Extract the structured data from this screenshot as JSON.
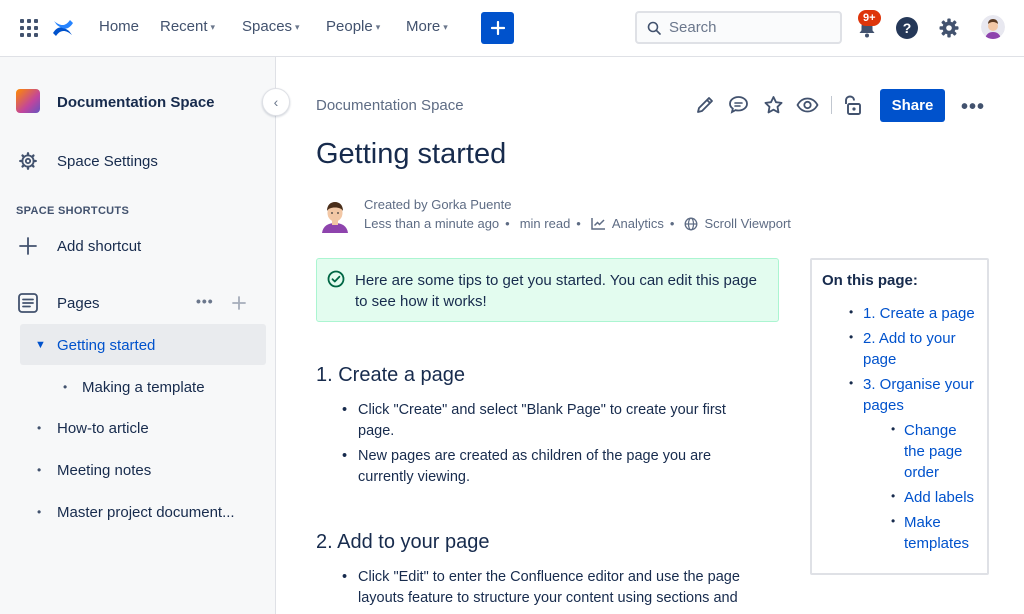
{
  "topnav": {
    "items": [
      {
        "label": "Home",
        "dropdown": false
      },
      {
        "label": "Recent",
        "dropdown": true
      },
      {
        "label": "Spaces",
        "dropdown": true
      },
      {
        "label": "People",
        "dropdown": true
      },
      {
        "label": "More",
        "dropdown": true
      }
    ],
    "search_placeholder": "Search",
    "notification_badge": "9+"
  },
  "sidebar": {
    "space_name": "Documentation Space",
    "space_settings": "Space Settings",
    "shortcuts_label": "SPACE SHORTCUTS",
    "add_shortcut": "Add shortcut",
    "pages_label": "Pages",
    "tree": [
      {
        "label": "Getting started",
        "selected": true
      },
      {
        "label": "Making a template"
      },
      {
        "label": "How-to article"
      },
      {
        "label": "Meeting notes"
      },
      {
        "label": "Master project document..."
      }
    ]
  },
  "page": {
    "breadcrumb": "Documentation Space",
    "share_label": "Share",
    "title": "Getting started",
    "created_by": "Created by Gorka Puente",
    "time": "Less than a minute ago",
    "read": "min read",
    "analytics": "Analytics",
    "viewport": "Scroll Viewport",
    "tip": "Here are some tips to get you started. You can edit this page to see how it works!",
    "sections": [
      {
        "heading": "1. Create a page",
        "bullets": [
          "Click \"Create\" and select \"Blank Page\" to create your first page.",
          "New pages are created as children of the page you are currently viewing."
        ]
      },
      {
        "heading": "2. Add to your page",
        "bullets": [
          "Click \"Edit\" to enter the Confluence editor and use the page layouts feature to structure your content using sections and"
        ]
      }
    ]
  },
  "toc": {
    "title": "On this page:",
    "items": [
      {
        "label": "1. Create a page"
      },
      {
        "label": "2. Add to your page"
      },
      {
        "label": "3. Organise your pages"
      },
      {
        "label": "Change the page order"
      },
      {
        "label": "Add labels"
      },
      {
        "label": "Make templates"
      }
    ]
  },
  "colors": {
    "brand": "#0052cc",
    "tip_bg": "#e3fcef",
    "badge": "#de350b"
  }
}
